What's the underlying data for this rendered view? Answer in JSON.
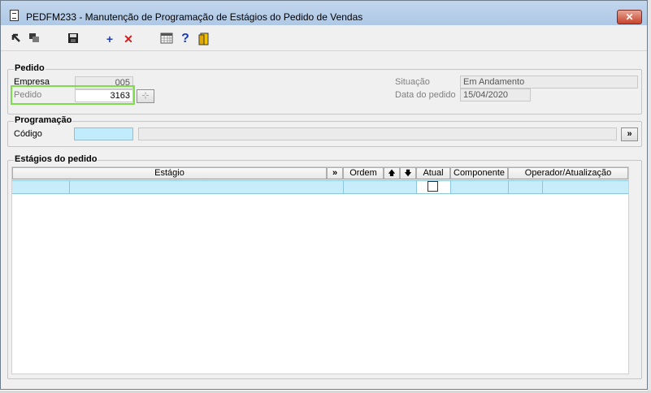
{
  "window": {
    "title": "PEDFM233 - Manutenção de Programação de Estágios do Pedido de Vendas",
    "close_label": "✕"
  },
  "toolbar": {
    "icons": [
      "back-arrow-icon",
      "copy-icon",
      "save-icon",
      "add-icon",
      "delete-icon",
      "calendar-grid-icon",
      "help-icon",
      "exit-door-icon"
    ],
    "add_glyph": "+",
    "delete_glyph": "✕",
    "help_glyph": "?"
  },
  "pedido": {
    "group_title": "Pedido",
    "empresa_label": "Empresa",
    "empresa_value": "005",
    "pedido_label": "Pedido",
    "pedido_value": "3163",
    "pedido_btn": "⊹",
    "situacao_label": "Situação",
    "situacao_value": "Em Andamento",
    "data_label": "Data do pedido",
    "data_value": "15/04/2020"
  },
  "programacao": {
    "group_title": "Programação",
    "codigo_label": "Código",
    "codigo_value": "",
    "descricao_value": "",
    "lookup_btn": "»"
  },
  "estagios": {
    "group_title": "Estágios do pedido",
    "columns": {
      "estagio": "Estágio",
      "more": "»",
      "ordem": "Ordem",
      "up": "🡅",
      "down": "🡇",
      "atual": "Atual",
      "componente": "Componente",
      "operador": "Operador/Atualização"
    },
    "rows": [
      {
        "estagio_cod": "",
        "estagio_desc": "",
        "ordem": "",
        "atual": false,
        "componente_cod": "",
        "componente_desc": "",
        "operador": ""
      }
    ]
  },
  "colors": {
    "field_cyan": "#c0ecfb",
    "highlight_green": "#7fdc4f",
    "close_red": "#c7442d"
  }
}
